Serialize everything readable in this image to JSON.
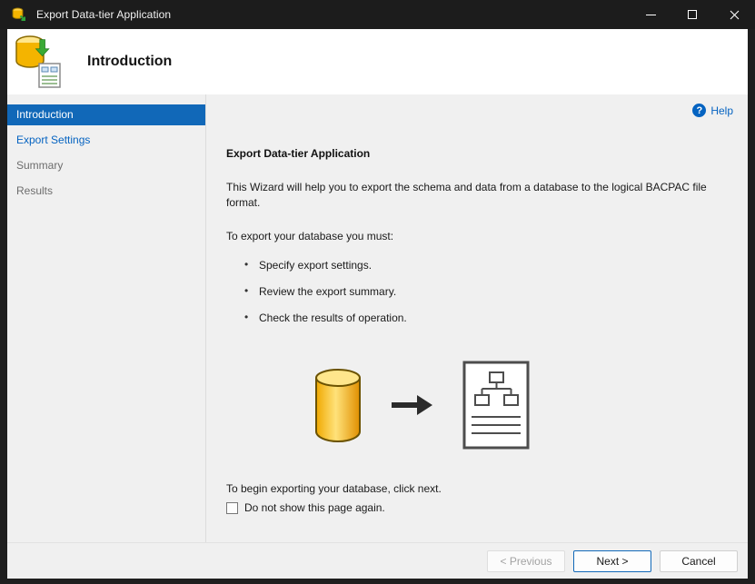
{
  "window": {
    "title": "Export Data-tier Application"
  },
  "header": {
    "title": "Introduction"
  },
  "sidebar": {
    "items": [
      {
        "label": "Introduction",
        "state": "active"
      },
      {
        "label": "Export Settings",
        "state": "enabled"
      },
      {
        "label": "Summary",
        "state": "disabled"
      },
      {
        "label": "Results",
        "state": "disabled"
      }
    ]
  },
  "content": {
    "help_label": "Help",
    "help_glyph": "?",
    "heading": "Export Data-tier Application",
    "intro": "This Wizard will help you to export the schema and data from a database to the logical BACPAC file format.",
    "steps_intro": "To export your database you must:",
    "bullets": [
      "Specify export settings.",
      "Review the export summary.",
      "Check the results of operation."
    ],
    "closing": "To begin exporting your database, click next.",
    "checkbox_label": "Do not show this page again.",
    "checkbox_checked": false
  },
  "footer": {
    "previous": "< Previous",
    "next": "Next >",
    "cancel": "Cancel"
  },
  "colors": {
    "accent_blue": "#1168b8",
    "link_blue": "#0563c1",
    "titlebar": "#1c1c1c",
    "db_yellow": "#f4b400"
  }
}
